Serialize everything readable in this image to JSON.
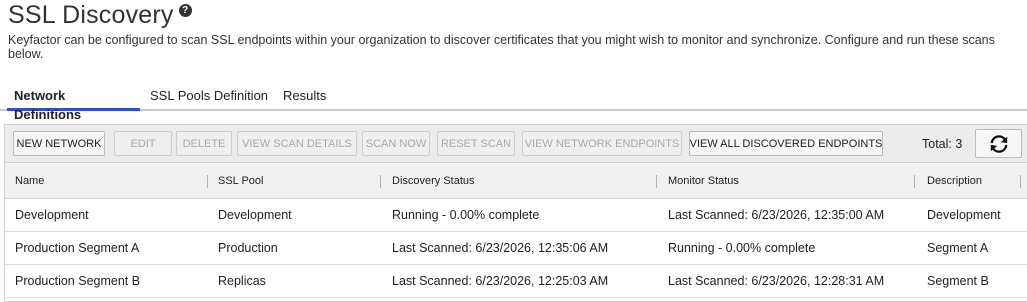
{
  "page": {
    "title": "SSL Discovery",
    "help_icon": "?",
    "description": "Keyfactor can be configured to scan SSL endpoints within your organization to discover certificates that you might wish to monitor and synchronize. Configure and run these scans below."
  },
  "tabs": [
    {
      "label": "Network Definitions",
      "active": true
    },
    {
      "label": "SSL Pools Definition",
      "active": false
    },
    {
      "label": "Results",
      "active": false
    }
  ],
  "toolbar": {
    "buttons": [
      {
        "label": "NEW NETWORK",
        "enabled": true
      },
      {
        "label": "EDIT",
        "enabled": false
      },
      {
        "label": "DELETE",
        "enabled": false
      },
      {
        "label": "VIEW SCAN DETAILS",
        "enabled": false
      },
      {
        "label": "SCAN NOW",
        "enabled": false
      },
      {
        "label": "RESET SCAN",
        "enabled": false
      },
      {
        "label": "VIEW NETWORK ENDPOINTS",
        "enabled": false
      },
      {
        "label": "VIEW ALL DISCOVERED ENDPOINTS",
        "enabled": true
      }
    ],
    "total_label": "Total: 3",
    "refresh_icon": "refresh-icon"
  },
  "table": {
    "columns": [
      "Name",
      "SSL Pool",
      "Discovery Status",
      "Monitor Status",
      "Description"
    ],
    "rows": [
      [
        "Development",
        "Development",
        "Running - 0.00% complete",
        "Last Scanned: 6/23/2026, 12:35:00 AM",
        "Development"
      ],
      [
        "Production Segment A",
        "Production",
        "Last Scanned: 6/23/2026, 12:35:06 AM",
        "Running - 0.00% complete",
        "Segment A"
      ],
      [
        "Production Segment B",
        "Replicas",
        "Last Scanned: 6/23/2026, 12:25:03 AM",
        "Last Scanned: 6/23/2026, 12:28:31 AM",
        "Segment B"
      ]
    ]
  },
  "colors": {
    "accent": "#2c4fd8",
    "toolbar_bg": "#ececec",
    "header_bg": "#f1f1f1"
  }
}
